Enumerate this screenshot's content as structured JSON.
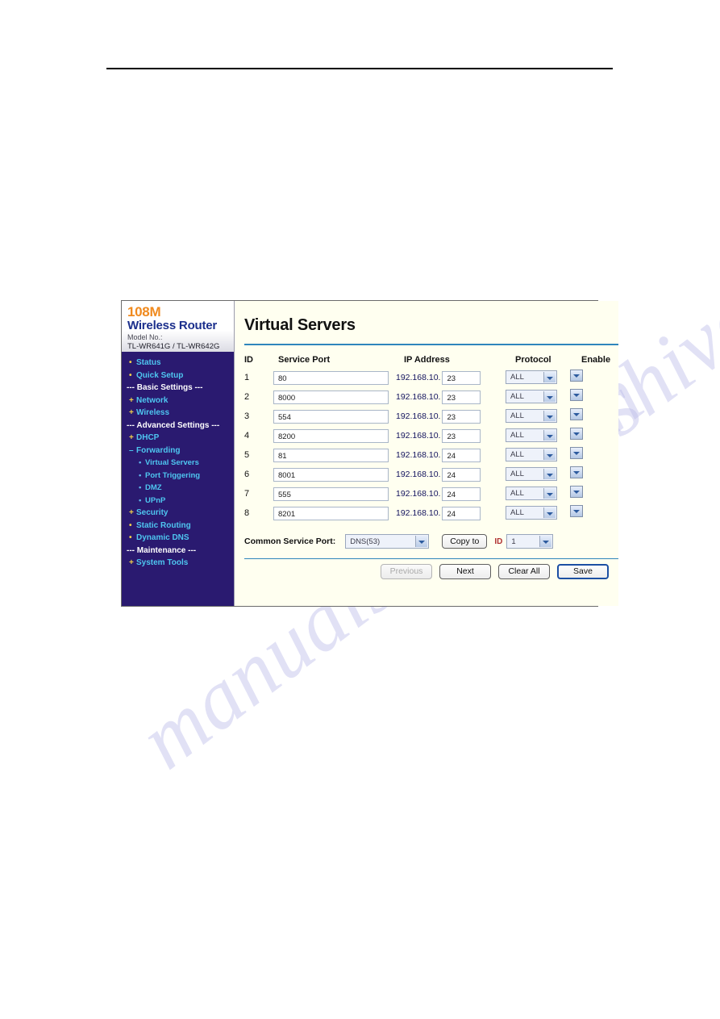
{
  "document": {
    "watermark_text": "manualshive.com"
  },
  "router_ui": {
    "brand": {
      "speed": "108M",
      "product": "Wireless  Router",
      "model_label": "Model No.:",
      "model_value": "TL-WR641G / TL-WR642G"
    },
    "menu": [
      {
        "label": "Status",
        "type": "item",
        "bullet": "•"
      },
      {
        "label": "Quick Setup",
        "type": "item",
        "bullet": "•"
      },
      {
        "label": "--- Basic Settings ---",
        "type": "section",
        "bullet": ""
      },
      {
        "label": "Network",
        "type": "item",
        "bullet": "+"
      },
      {
        "label": "Wireless",
        "type": "item",
        "bullet": "+"
      },
      {
        "label": "--- Advanced Settings ---",
        "type": "section",
        "bullet": ""
      },
      {
        "label": "DHCP",
        "type": "item",
        "bullet": "+"
      },
      {
        "label": "Forwarding",
        "type": "open",
        "bullet": "–"
      },
      {
        "label": "Virtual Servers",
        "type": "sub",
        "bullet": "•"
      },
      {
        "label": "Port Triggering",
        "type": "sub",
        "bullet": "•"
      },
      {
        "label": "DMZ",
        "type": "sub",
        "bullet": "•"
      },
      {
        "label": "UPnP",
        "type": "sub",
        "bullet": "•"
      },
      {
        "label": "Security",
        "type": "item",
        "bullet": "+"
      },
      {
        "label": "Static Routing",
        "type": "item",
        "bullet": "•"
      },
      {
        "label": "Dynamic DNS",
        "type": "item",
        "bullet": "•"
      },
      {
        "label": "--- Maintenance ---",
        "type": "section",
        "bullet": ""
      },
      {
        "label": "System Tools",
        "type": "item",
        "bullet": "+"
      }
    ],
    "page_title": "Virtual Servers",
    "table": {
      "headers": {
        "id": "ID",
        "service_port": "Service Port",
        "ip_address": "IP Address",
        "protocol": "Protocol",
        "enable": "Enable"
      },
      "ip_prefix": "192.168.10.",
      "rows": [
        {
          "id": "1",
          "service_port": "80",
          "ip_suffix": "23",
          "protocol": "ALL"
        },
        {
          "id": "2",
          "service_port": "8000",
          "ip_suffix": "23",
          "protocol": "ALL"
        },
        {
          "id": "3",
          "service_port": "554",
          "ip_suffix": "23",
          "protocol": "ALL"
        },
        {
          "id": "4",
          "service_port": "8200",
          "ip_suffix": "23",
          "protocol": "ALL"
        },
        {
          "id": "5",
          "service_port": "81",
          "ip_suffix": "24",
          "protocol": "ALL"
        },
        {
          "id": "6",
          "service_port": "8001",
          "ip_suffix": "24",
          "protocol": "ALL"
        },
        {
          "id": "7",
          "service_port": "555",
          "ip_suffix": "24",
          "protocol": "ALL"
        },
        {
          "id": "8",
          "service_port": "8201",
          "ip_suffix": "24",
          "protocol": "ALL"
        }
      ]
    },
    "common_service_port": {
      "label": "Common Service Port:",
      "selected": "DNS(53)",
      "copy_to_label": "Copy to",
      "id_label": "ID",
      "id_selected": "1"
    },
    "footer_buttons": {
      "previous": "Previous",
      "next": "Next",
      "clear_all": "Clear All",
      "save": "Save"
    },
    "colors": {
      "sidebar_bg": "#2a1a70",
      "menu_link": "#4ec6f0",
      "brand_orange": "#f08a1e",
      "brand_blue": "#1b2f8c",
      "divider_blue": "#2f86bc",
      "content_bg": "#fffff0"
    }
  }
}
